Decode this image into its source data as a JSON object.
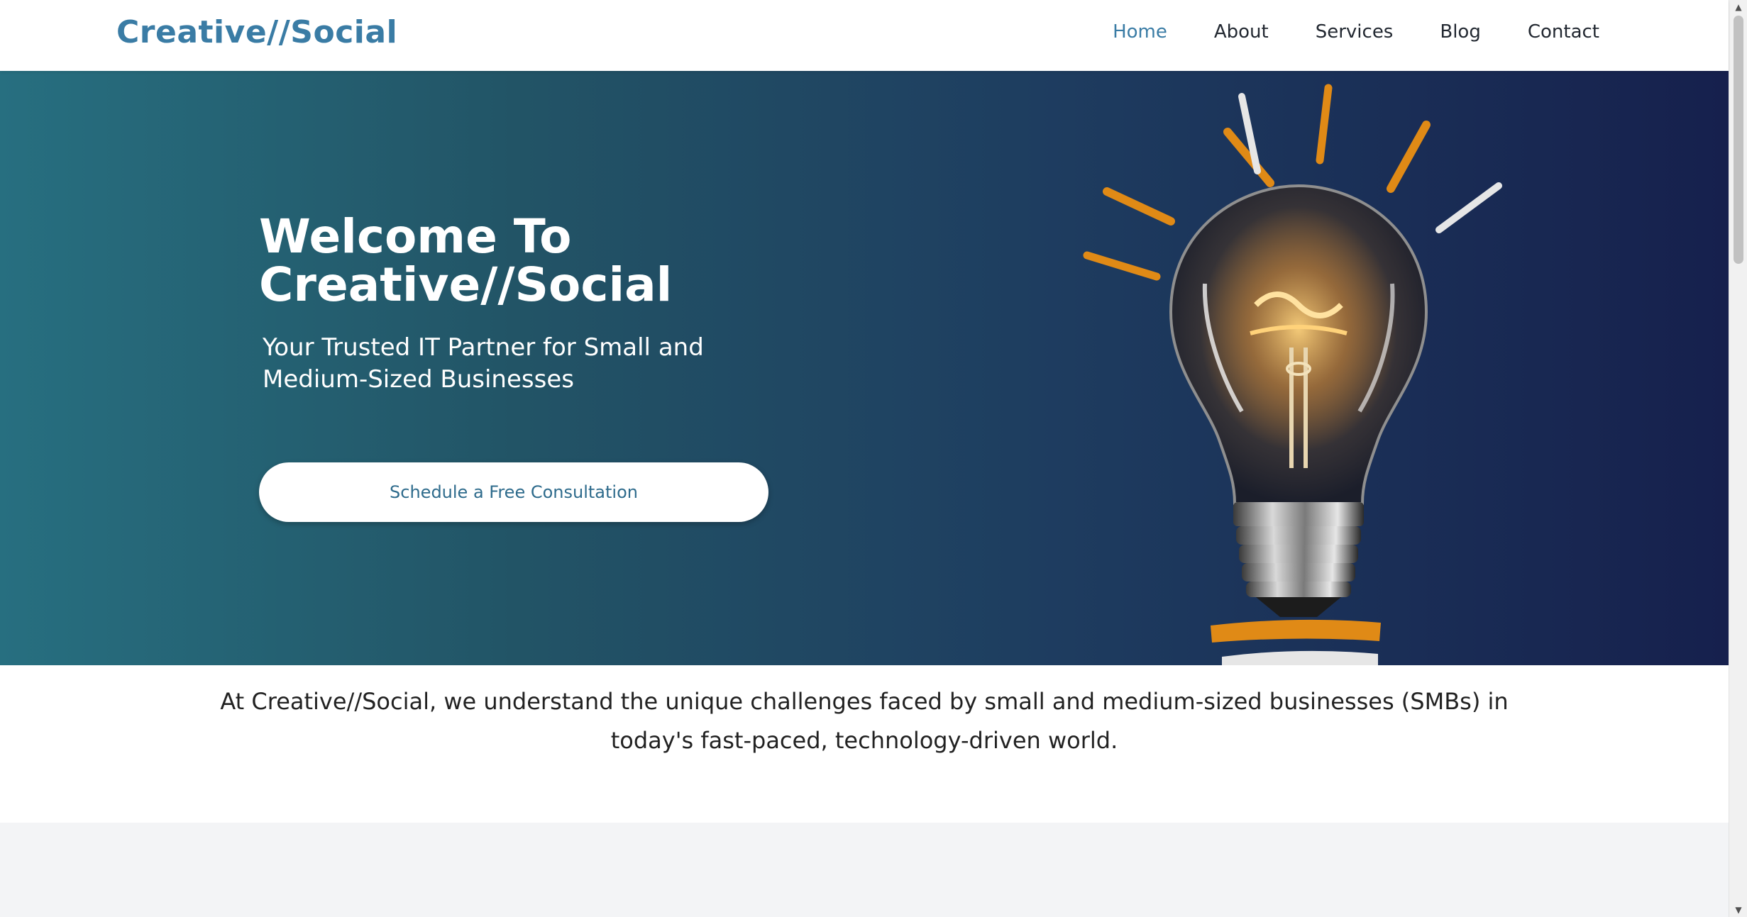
{
  "nav": {
    "brand": "Creative//Social",
    "links": [
      "Home",
      "About",
      "Services",
      "Blog",
      "Contact"
    ],
    "active": "Home"
  },
  "hero": {
    "title_line1": "Welcome To",
    "title_line2": "Creative//Social",
    "subtitle": "Your Trusted IT Partner for Small and Medium-Sized Businesses",
    "cta": "Schedule a Free Consultation",
    "image_icon": "lightbulb-icon"
  },
  "intro": {
    "text": "At Creative//Social, we understand the unique challenges faced by small and medium-sized businesses (SMBs) in today's fast-paced, technology-driven world."
  },
  "scrollbar": {
    "up_icon": "scroll-up-arrow-icon",
    "down_icon": "scroll-down-arrow-icon"
  },
  "colors": {
    "brand": "#3a7ca5",
    "hero_gradient_start": "#276f80",
    "hero_gradient_end": "#16204d",
    "accent_orange": "#e08a16",
    "section_gray": "#f3f4f6"
  }
}
